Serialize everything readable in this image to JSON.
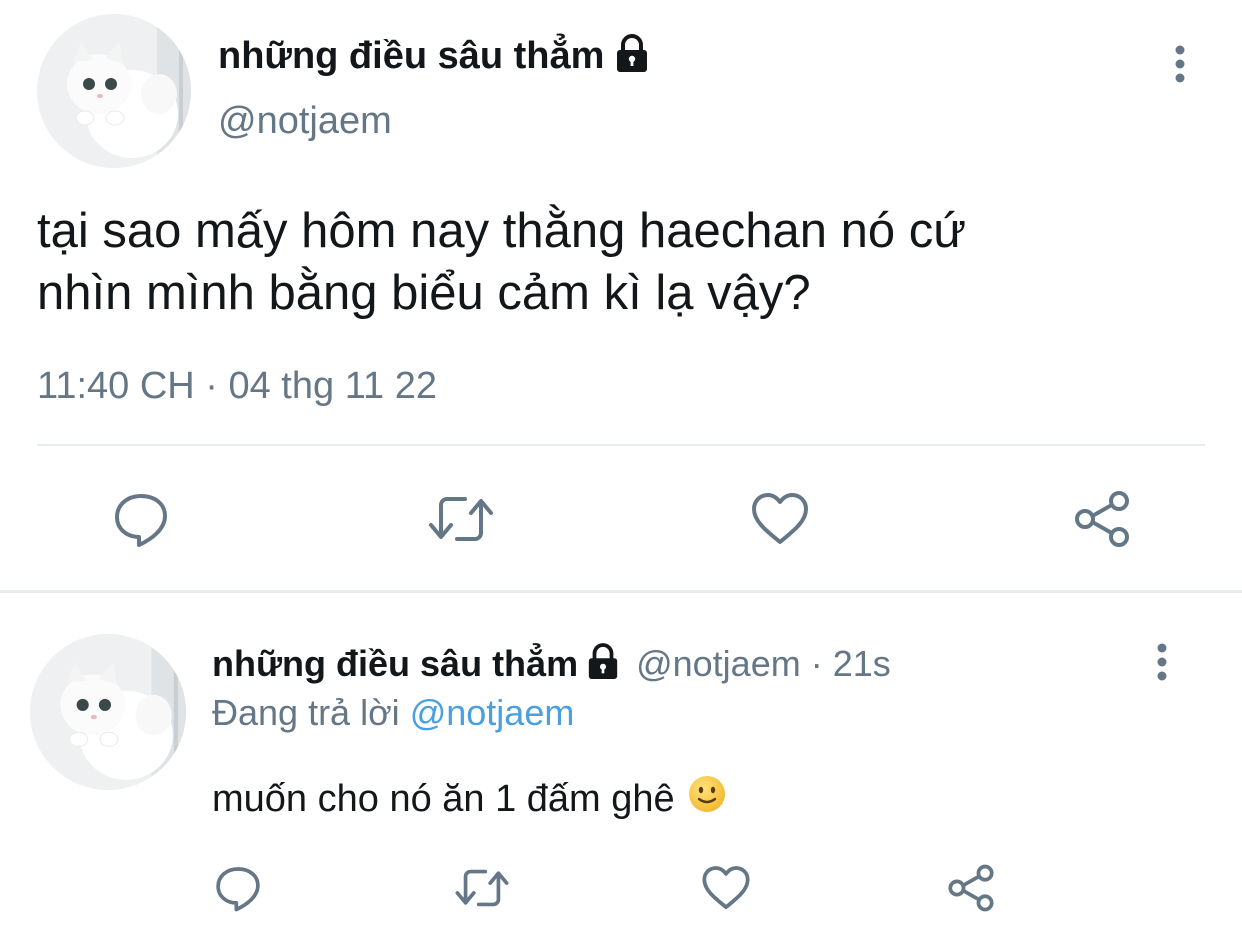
{
  "main_tweet": {
    "display_name": "những điều sâu thẳm",
    "handle": "@notjaem",
    "text_line1": "tại sao mấy hôm nay thằng haechan nó cứ",
    "text_line2": "nhìn mình bằng biểu cảm kì lạ vậy?",
    "timestamp": "11:40 CH · 04 thg 11 22",
    "icons": {
      "avatar": "cat-avatar",
      "lock": "lock-icon",
      "more": "more-vertical-icon",
      "reply": "reply-icon",
      "retweet": "retweet-icon",
      "like": "heart-icon",
      "share": "share-icon"
    }
  },
  "reply_tweet": {
    "display_name": "những điều sâu thẳm",
    "handle_time": "@notjaem · 21s",
    "replying_prefix": "Đang trả lời",
    "replying_to": "@notjaem",
    "text": "muốn cho nó ăn 1 đấm ghê",
    "emoji": "🙂"
  },
  "colors": {
    "text": "#14171a",
    "muted": "#657786",
    "link": "#4a9fe0",
    "divider": "#e6ecf0"
  }
}
